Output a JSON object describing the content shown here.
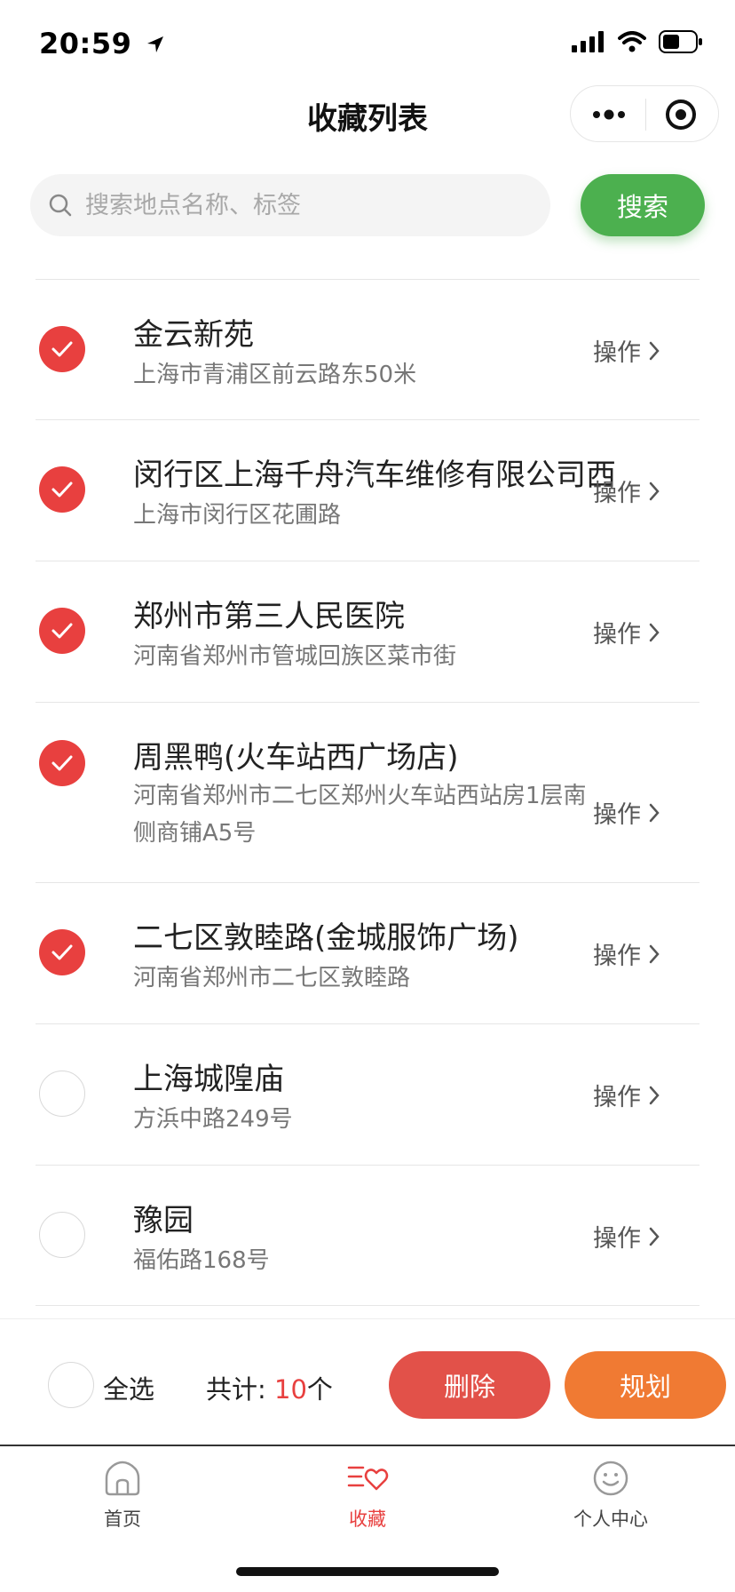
{
  "status": {
    "time": "20:59"
  },
  "nav": {
    "title": "收藏列表"
  },
  "search": {
    "placeholder": "搜索地点名称、标签",
    "button": "搜索"
  },
  "list": {
    "op_label": "操作",
    "items": [
      {
        "name": "金云新苑",
        "address": "上海市青浦区前云路东50米",
        "checked": true
      },
      {
        "name": "闵行区上海千舟汽车维修有限公司西",
        "address": "上海市闵行区花圃路",
        "checked": true
      },
      {
        "name": "郑州市第三人民医院",
        "address": "河南省郑州市管城回族区菜市街",
        "checked": true
      },
      {
        "name": "周黑鸭(火车站西广场店)",
        "address": "河南省郑州市二七区郑州火车站西站房1层南侧商铺A5号",
        "checked": true
      },
      {
        "name": "二七区敦睦路(金城服饰广场)",
        "address": "河南省郑州市二七区敦睦路",
        "checked": true
      },
      {
        "name": "上海城隍庙",
        "address": "方浜中路249号",
        "checked": false
      },
      {
        "name": "豫园",
        "address": "福佑路168号",
        "checked": false
      }
    ]
  },
  "action_bar": {
    "select_all": "全选",
    "total_prefix": "共计: ",
    "total_count": "10",
    "total_suffix": "个",
    "delete": "删除",
    "plan": "规划"
  },
  "tabs": [
    {
      "label": "首页",
      "icon": "home-icon",
      "active": false
    },
    {
      "label": "收藏",
      "icon": "favorites-icon",
      "active": true
    },
    {
      "label": "个人中心",
      "icon": "profile-icon",
      "active": false
    }
  ],
  "colors": {
    "accent_red": "#e8403f",
    "search_green": "#4cb04f",
    "delete_red": "#e25149",
    "plan_orange": "#f07a33"
  }
}
